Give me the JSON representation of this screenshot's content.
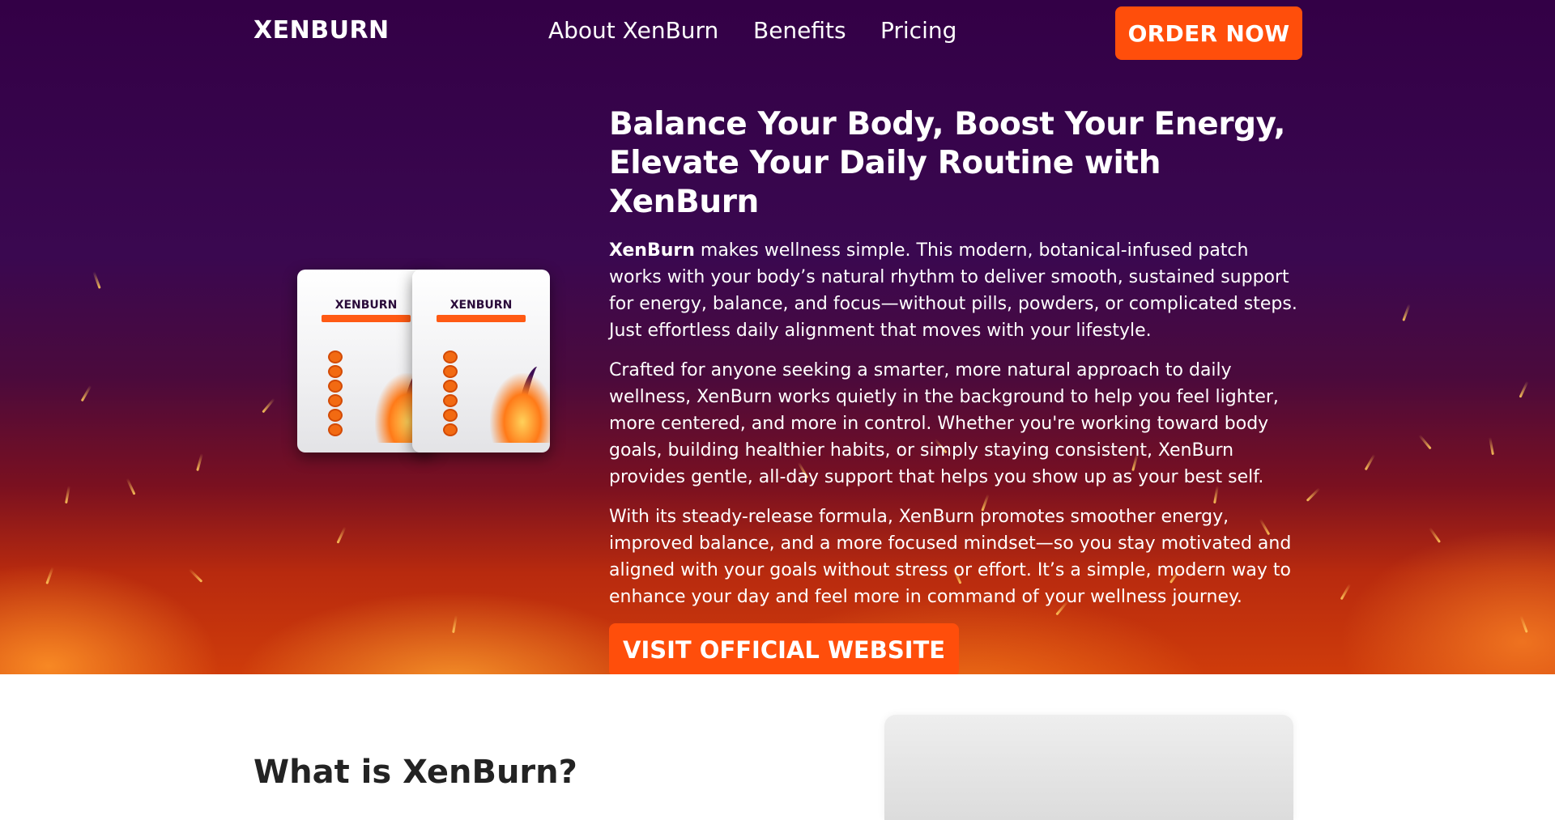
{
  "navbar": {
    "brand": "XENBURN",
    "links": [
      "About XenBurn",
      "Benefits",
      "Pricing"
    ],
    "order_label": "ORDER NOW"
  },
  "hero": {
    "headline": "Balance Your Body, Boost Your Energy, Elevate Your Daily Routine with XenBurn",
    "intro_bold": "XenBurn",
    "intro_rest": " makes wellness simple. This modern, botanical-infused patch works with your body’s natural rhythm to deliver smooth, sustained support for energy, balance, and focus—without pills, powders, or complicated steps. Just effortless daily alignment that moves with your lifestyle.",
    "paragraph_2": "Crafted for anyone seeking a smarter, more natural approach to daily wellness, XenBurn works quietly in the background to help you feel lighter, more centered, and more in control. Whether you're working toward body goals, building healthier habits, or simply staying consistent, XenBurn provides gentle, all-day support that helps you show up as your best self.",
    "paragraph_3": "With its steady-release formula, XenBurn promotes smoother energy, improved balance, and a more focused mindset—so you stay motivated and aligned with your goals without stress or effort. It’s a simple, modern way to enhance your day and feel more in command of your wellness journey.",
    "cta_label": "VISIT OFFICIAL WEBSITE"
  },
  "product_image": {
    "pouch_brand": "XENBURN"
  },
  "section2": {
    "title": "What is XenBurn?"
  },
  "colors": {
    "accent": "#ff4e0b",
    "hero_top": "#330046",
    "hero_bottom": "#cf3c0b"
  }
}
